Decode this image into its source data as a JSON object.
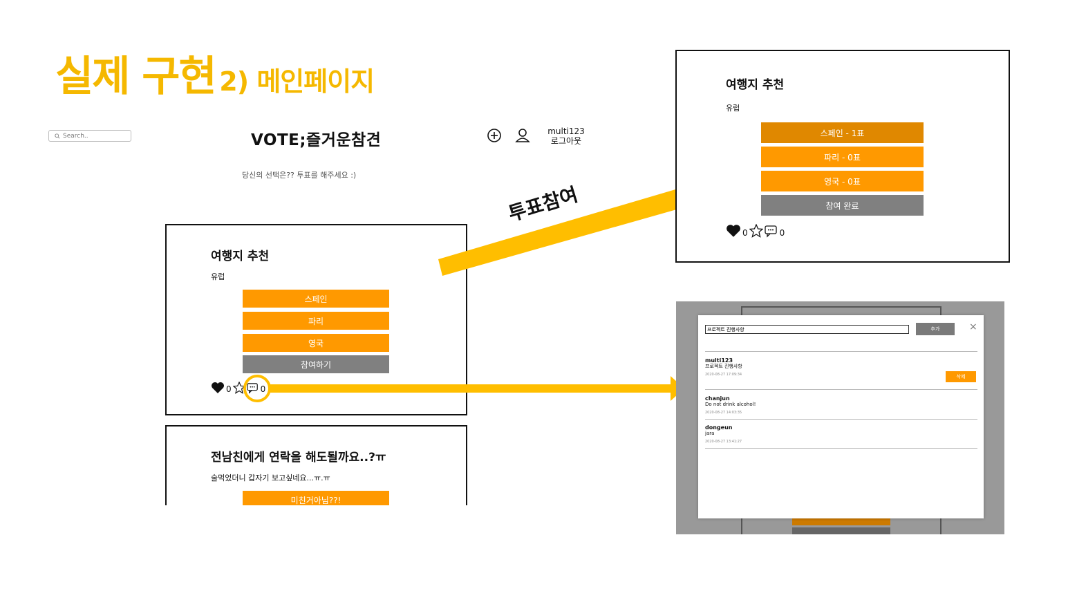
{
  "slide": {
    "title_main": "실제 구현",
    "title_sub": "2) 메인페이지"
  },
  "header": {
    "search_placeholder": "Search..",
    "brand": "VOTE;즐거운참견",
    "username": "multi123",
    "logout": "로그아웃",
    "subtitle": "당신의 선택은?? 투표를 해주세요 :)"
  },
  "poll_card": {
    "title": "여행지 추천",
    "subtitle": "유럽",
    "options": [
      "스페인",
      "파리",
      "영국"
    ],
    "submit": "참여하기",
    "like_count": "0",
    "comment_count": "0"
  },
  "poll_card_2": {
    "title": "전남친에게 연락을 해도될까요..?ㅠ",
    "subtitle": "술먹었더니 갑자기 보고싶네요...ㅠ.ㅠ",
    "options": [
      "미친거아님??!"
    ]
  },
  "annotation": {
    "arrow_label": "투표참여"
  },
  "result_card": {
    "title": "여행지 추천",
    "subtitle": "유럽",
    "options": [
      "스페인 - 1표",
      "파리 - 0표",
      "영국 - 0표"
    ],
    "submit": "참여 완료",
    "like_count": "0",
    "comment_count": "0"
  },
  "comment_modal": {
    "input_value": "프로젝트 진행사항",
    "add_label": "추가",
    "close": "×",
    "delete_label": "삭제",
    "comments": [
      {
        "user": "multi123",
        "text": "프로젝트 진행사항",
        "date": "2020-08-27 17:09:34"
      },
      {
        "user": "chanjun",
        "text": "Do not drink alcohol!",
        "date": "2020-08-27 14:03:35"
      },
      {
        "user": "dongeun",
        "text": "jara",
        "date": "2020-08-27 13:41:27"
      }
    ]
  },
  "colors": {
    "accent": "#f5b800",
    "option": "#ff9900",
    "option_selected": "#e08800",
    "disabled": "#808080"
  }
}
